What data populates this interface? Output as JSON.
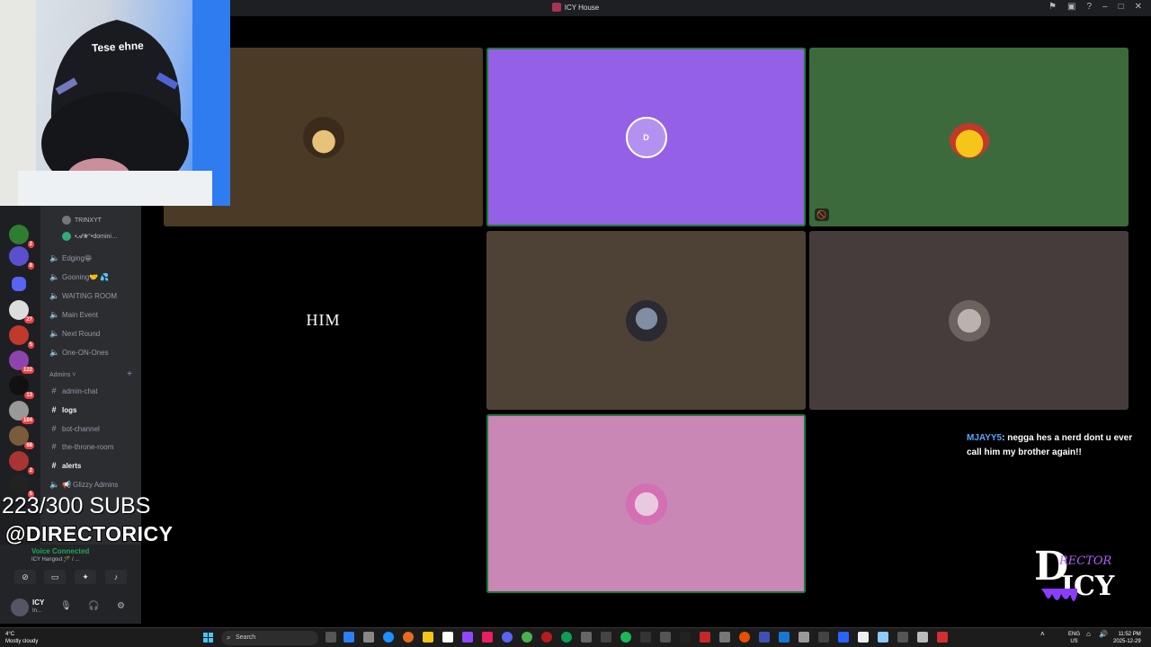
{
  "window": {
    "title": "ICY House"
  },
  "overlay": {
    "subs_text": "223/300 SUBS",
    "handle_text": "@DIRECTORICY",
    "chair_text": "Tese ehne",
    "chat": {
      "user": "MJAYY5",
      "message": ": negga hes a nerd dont u ever call him my brother again!!"
    },
    "logo_text_top": "RECTOR",
    "logo_text_bottom": "ICY",
    "logo_initial": "D"
  },
  "sidebar": {
    "server_badges": [
      "2",
      "8",
      "27",
      "5",
      "122",
      "13",
      "184",
      "68",
      "2",
      "5"
    ],
    "voice_members": [
      "TRINXYT",
      "•𝓐❀°•domini…"
    ],
    "channels": [
      {
        "name": "Edging😁",
        "type": "voice"
      },
      {
        "name": "Gooning🤝 💦",
        "type": "voice"
      },
      {
        "name": "WAITING ROOM",
        "type": "voice"
      },
      {
        "name": "Main Event",
        "type": "voice"
      },
      {
        "name": "Next Round",
        "type": "voice"
      },
      {
        "name": "One-ON-Ones",
        "type": "voice"
      }
    ],
    "category": "Admins",
    "admin_channels": [
      {
        "name": "admin-chat",
        "type": "text",
        "bold": false
      },
      {
        "name": "logs",
        "type": "text",
        "bold": true
      },
      {
        "name": "bot-channel",
        "type": "text",
        "bold": false
      },
      {
        "name": "the-throne-room",
        "type": "text",
        "bold": false
      },
      {
        "name": "alerts",
        "type": "text",
        "bold": true
      },
      {
        "name": "📢 Glizzy Admins",
        "type": "voice",
        "bold": false
      }
    ],
    "voice_status": "Voice Connected",
    "voice_channel": "ICY Hangout 🪄 / ...",
    "user": {
      "name": "ICY",
      "status": "In..."
    }
  },
  "stage": {
    "tiles": [
      {
        "id": "tile-1",
        "bg": "#4b3b26",
        "avatar": "straw-hat-avatar",
        "label": ""
      },
      {
        "id": "tile-2",
        "bg": "#9461e6",
        "avatar": "dicy-logo-avatar",
        "label": "",
        "speaking": true
      },
      {
        "id": "tile-3",
        "bg": "#3c6a3c",
        "avatar": "pikachu-avatar",
        "label": "",
        "muted": true
      },
      {
        "id": "tile-4",
        "bg": "#000000",
        "avatar": "",
        "label": "HIM"
      },
      {
        "id": "tile-5",
        "bg": "#4e4237",
        "avatar": "helmet-avatar",
        "label": ""
      },
      {
        "id": "tile-6",
        "bg": "#453c3b",
        "avatar": "cat-avatar",
        "label": ""
      },
      {
        "id": "tile-7",
        "bg": "#c987b5",
        "avatar": "pink-avatar",
        "label": "",
        "speaking": true
      }
    ]
  },
  "taskbar": {
    "weather_temp": "4°C",
    "weather_desc": "Mostly cloudy",
    "search_placeholder": "Search",
    "lang_top": "ENG",
    "lang_bottom": "US",
    "time": "11:52 PM",
    "date": "2025-12-29"
  },
  "colors": {
    "discord_dark": "#1e1f22",
    "accent_green": "#23a55a",
    "badge_red": "#f23f43"
  }
}
